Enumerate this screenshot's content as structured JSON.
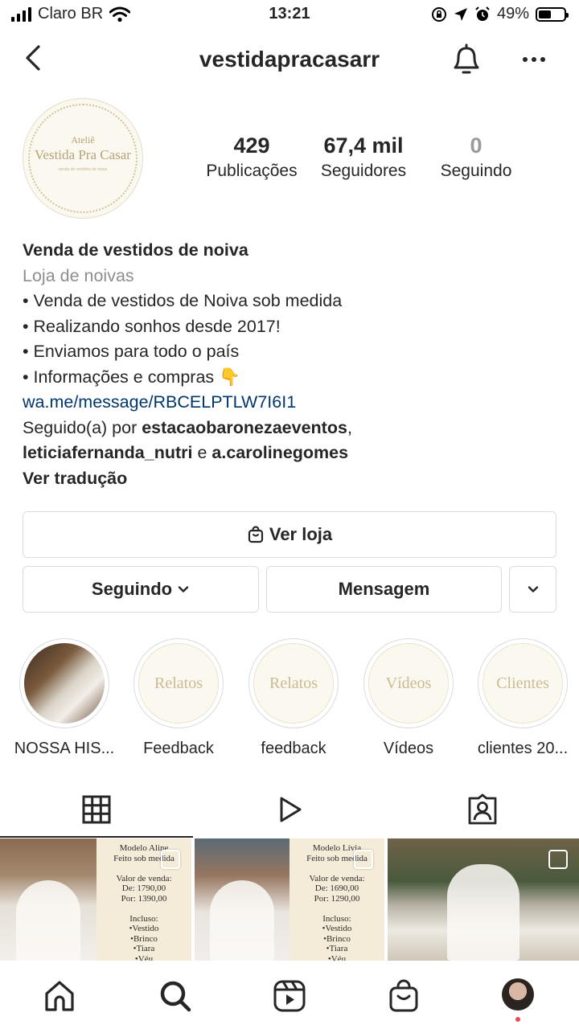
{
  "status_bar": {
    "carrier": "Claro BR",
    "time": "13:21",
    "battery": "49%",
    "battery_level": 0.49
  },
  "header": {
    "username": "vestidapracasarr"
  },
  "avatar": {
    "small_text": "Ateliê",
    "title_text": "Vestida Pra Casar",
    "sub_text": "venda de vestidos de noiva"
  },
  "stats": [
    {
      "value": "429",
      "label": "Publicações"
    },
    {
      "value": "67,4 mil",
      "label": "Seguidores"
    },
    {
      "value": "0",
      "label": "Seguindo"
    }
  ],
  "bio": {
    "name": "Venda de vestidos de noiva",
    "category": "Loja de noivas",
    "lines": [
      "• Venda de vestidos de Noiva sob medida",
      "• Realizando sonhos desde 2017!",
      "• Enviamos para todo o país",
      "• Informações e compras 👇"
    ],
    "link": "wa.me/message/RBCELPTLW7I6I1",
    "followed_by_prefix": "Seguido(a) por ",
    "follower_1": "estacaobaronezaeventos",
    "follower_sep": ",",
    "follower_2": "leticiafernanda_nutri",
    "follower_and": " e ",
    "follower_3": "a.carolinegomes",
    "translate": "Ver tradução"
  },
  "buttons": {
    "shop": "Ver loja",
    "following": "Seguindo",
    "message": "Mensagem"
  },
  "highlights": [
    {
      "label": "NOSSA HIS...",
      "cover_text": ""
    },
    {
      "label": "Feedback",
      "cover_text": "Relatos"
    },
    {
      "label": "feedback",
      "cover_text": "Relatos"
    },
    {
      "label": "Vídeos",
      "cover_text": "Vídeos"
    },
    {
      "label": "clientes 20...",
      "cover_text": "Clientes"
    }
  ],
  "posts": {
    "card_1": "Modelo Aline\nFeito sob medida\n\nValor de venda:\nDe: 1790,00\nPor: 1390,00\n\nIncluso:\n•Vestido\n•Brinco\n•Tiara\n•Véu",
    "card_2": "Modelo Lívia\nFeito sob medida\n\nValor de venda:\nDe: 1690,00\nPor: 1290,00\n\nIncluso:\n•Vestido\n•Brinco\n•Tiara\n•Véu"
  },
  "colors": {
    "link": "#00376b",
    "secondary_text": "#8e8e8e",
    "notification_dot": "#ed4956",
    "border": "#dbdbdb"
  }
}
